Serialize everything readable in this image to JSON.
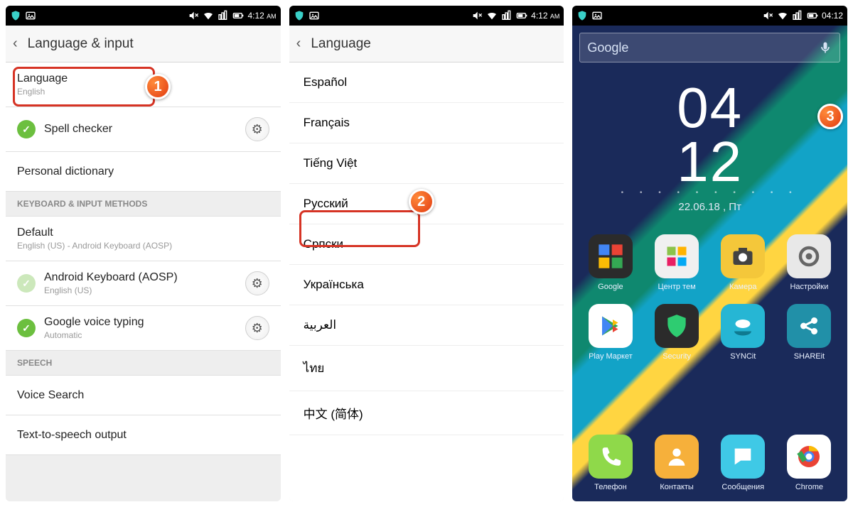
{
  "statusbar": {
    "time_12h": "4:12",
    "ampm": "AM",
    "time_24h": "04:12"
  },
  "screen1": {
    "title": "Language & input",
    "language_row": {
      "primary": "Language",
      "secondary": "English"
    },
    "spellchecker": "Spell checker",
    "personal_dictionary": "Personal dictionary",
    "section_keyboard": "KEYBOARD & INPUT METHODS",
    "default_row": {
      "primary": "Default",
      "secondary": "English (US) - Android Keyboard (AOSP)"
    },
    "aosp_row": {
      "primary": "Android Keyboard (AOSP)",
      "secondary": "English (US)"
    },
    "gvoice_row": {
      "primary": "Google voice typing",
      "secondary": "Automatic"
    },
    "section_speech": "SPEECH",
    "voice_search": "Voice Search",
    "tts": "Text-to-speech output",
    "badge": "1"
  },
  "screen2": {
    "title": "Language",
    "options": [
      "Español",
      "Français",
      "Tiếng Việt",
      "Русский",
      "Српски",
      "Українська",
      "العربية",
      "ไทย",
      "中文 (简体)"
    ],
    "highlight_index": 3,
    "badge": "2"
  },
  "screen3": {
    "search_placeholder": "Google",
    "clock": {
      "hh": "04",
      "mm": "12",
      "date": "22.06.18 , Пт"
    },
    "apps_row1": [
      {
        "label": "Google",
        "bg": "#2b2b2b"
      },
      {
        "label": "Центр тем",
        "bg": "#f0f0f0"
      },
      {
        "label": "Камера",
        "bg": "#f4c73a"
      },
      {
        "label": "Настройки",
        "bg": "#e8e8e8"
      }
    ],
    "apps_row2": [
      {
        "label": "Play Маркет",
        "bg": "#ffffff"
      },
      {
        "label": "Security",
        "bg": "#2b2b2b"
      },
      {
        "label": "SYNCit",
        "bg": "#26b6d4"
      },
      {
        "label": "SHAREit",
        "bg": "#2190a8"
      }
    ],
    "dock": [
      {
        "label": "Телефон",
        "bg": "#8fd94a"
      },
      {
        "label": "Контакты",
        "bg": "#f6b03b"
      },
      {
        "label": "Сообщения",
        "bg": "#3fc9e6"
      },
      {
        "label": "Chrome",
        "bg": "#ffffff"
      }
    ],
    "badge": "3"
  }
}
